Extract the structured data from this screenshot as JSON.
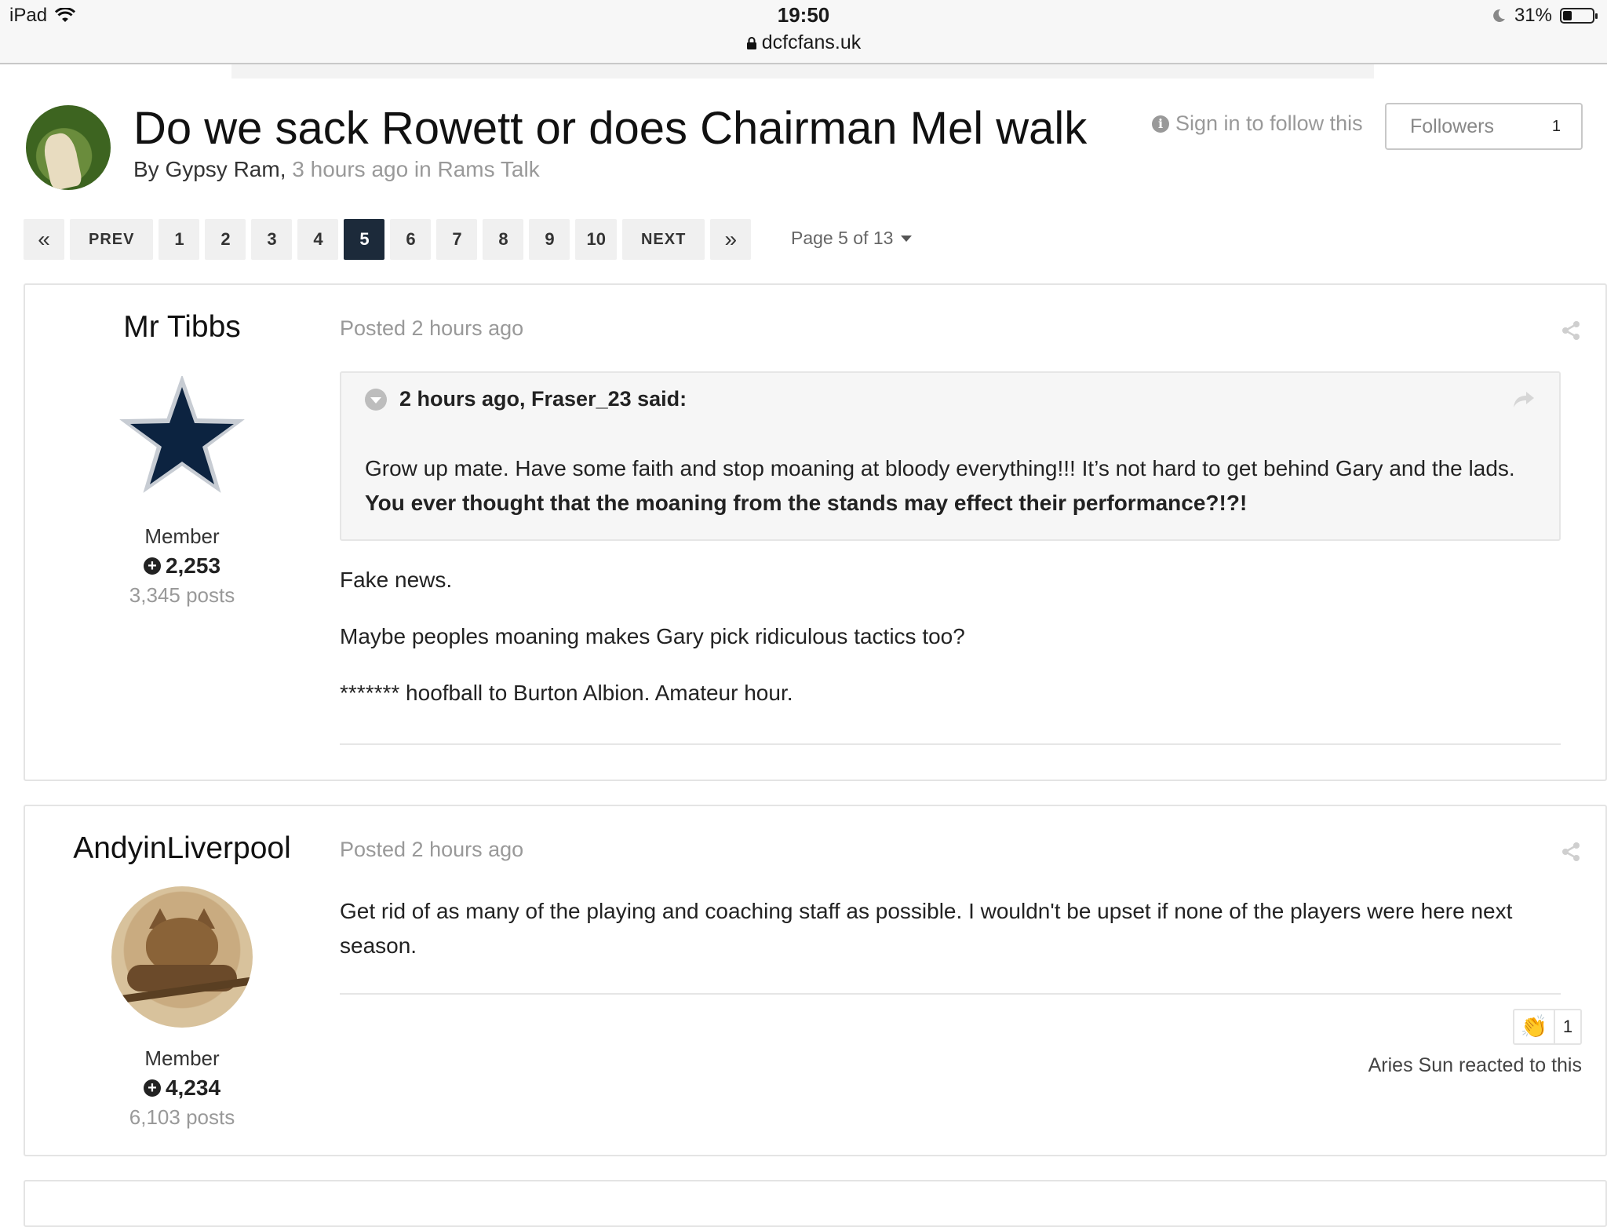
{
  "status_bar": {
    "device": "iPad",
    "time": "19:50",
    "url": "dcfcfans.uk",
    "battery": "31%",
    "battery_level": 0.31
  },
  "topic": {
    "title": "Do we sack Rowett or does Chairman Mel walk",
    "by_prefix": "By Gypsy Ram,",
    "meta_suffix": "3 hours ago in Rams Talk",
    "follow_text": "Sign in to follow this",
    "followers_label": "Followers",
    "followers_count": "1"
  },
  "pagination": {
    "first": "«",
    "prev": "PREV",
    "pages": [
      "1",
      "2",
      "3",
      "4",
      "5",
      "6",
      "7",
      "8",
      "9",
      "10"
    ],
    "current": "5",
    "next": "NEXT",
    "last": "»",
    "page_jump": "Page 5 of 13"
  },
  "posts": [
    {
      "author": "Mr Tibbs",
      "role": "Member",
      "reputation": "2,253",
      "post_count": "3,345 posts",
      "posted": "Posted 2 hours ago",
      "quote": {
        "header": "2 hours ago, Fraser_23 said:",
        "text_plain": "Grow up mate. Have some faith and stop moaning at bloody everything!!! It’s not hard to get behind Gary and the lads.",
        "text_bold": "You ever thought that the moaning from the stands may effect their performance?!?!"
      },
      "paragraphs": [
        "Fake news.",
        "Maybe peoples moaning makes Gary pick ridiculous tactics too?",
        "******* hoofball to Burton Albion. Amateur hour."
      ]
    },
    {
      "author": "AndyinLiverpool",
      "role": "Member",
      "reputation": "4,234",
      "post_count": "6,103 posts",
      "posted": "Posted 2 hours ago",
      "paragraphs": [
        "Get rid of as many of the playing and coaching staff as possible. I wouldn't be upset if none of the players were here next season."
      ],
      "reaction": {
        "emoji": "👏",
        "emoji_name": "clapping-hands-icon",
        "count": "1",
        "text": "Aries Sun reacted to this"
      }
    }
  ],
  "colors": {
    "active_page": "#1c2a3a",
    "muted_text": "#999999",
    "star_navy": "#0c2340"
  }
}
